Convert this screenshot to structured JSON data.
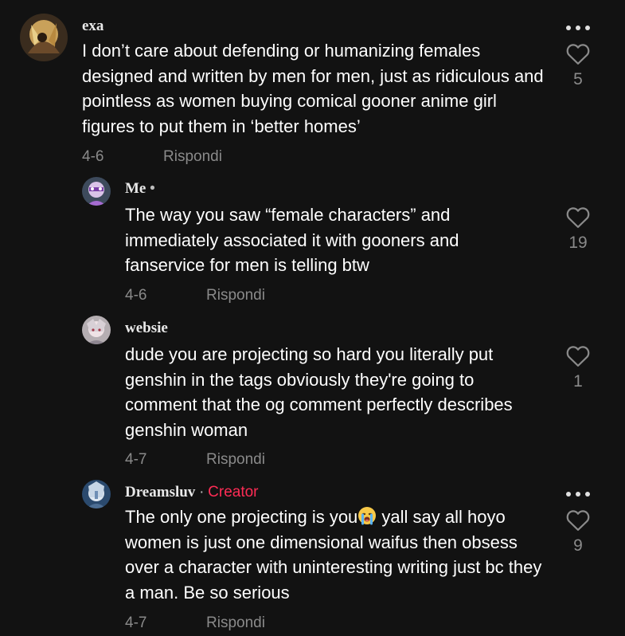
{
  "comments": [
    {
      "author": "exa",
      "badge": "",
      "text": "I don’t care about defending or humanizing females designed and written by men for men, just as ridiculous and pointless as women buying comical gooner anime girl figures to put them in ‘better homes’",
      "date": "4-6",
      "reply_label": "Rispondi",
      "likes": "5"
    },
    {
      "author": "Me",
      "badge": "•",
      "text": "The way you saw “female characters” and immediately associated it with gooners and fanservice for men is telling btw",
      "date": "4-6",
      "reply_label": "Rispondi",
      "likes": "19"
    },
    {
      "author": "websie",
      "badge": "",
      "text": "dude you are projecting so hard you literally put genshin in the tags obviously they're going to comment that the og comment perfectly describes genshin woman",
      "date": "4-7",
      "reply_label": "Rispondi",
      "likes": "1"
    },
    {
      "author": "Dreamsluv",
      "badge": "·",
      "creator_label": "Creator",
      "text_before_emoji": "The only one projecting is you",
      "emoji": "loudly-crying-face-icon",
      "text_after_emoji": " yall say all hoyo women is just one dimensional waifus then obsess over a character with uninteresting writing just bc they a man. Be so serious",
      "date": "4-7",
      "reply_label": "Rispondi",
      "likes": "9"
    }
  ],
  "icons": {
    "more": "more-options-icon",
    "like": "heart-outline-icon"
  },
  "colors": {
    "background": "#121212",
    "text": "#ffffff",
    "muted": "#8a8a8a",
    "creator": "#fe2c55"
  }
}
